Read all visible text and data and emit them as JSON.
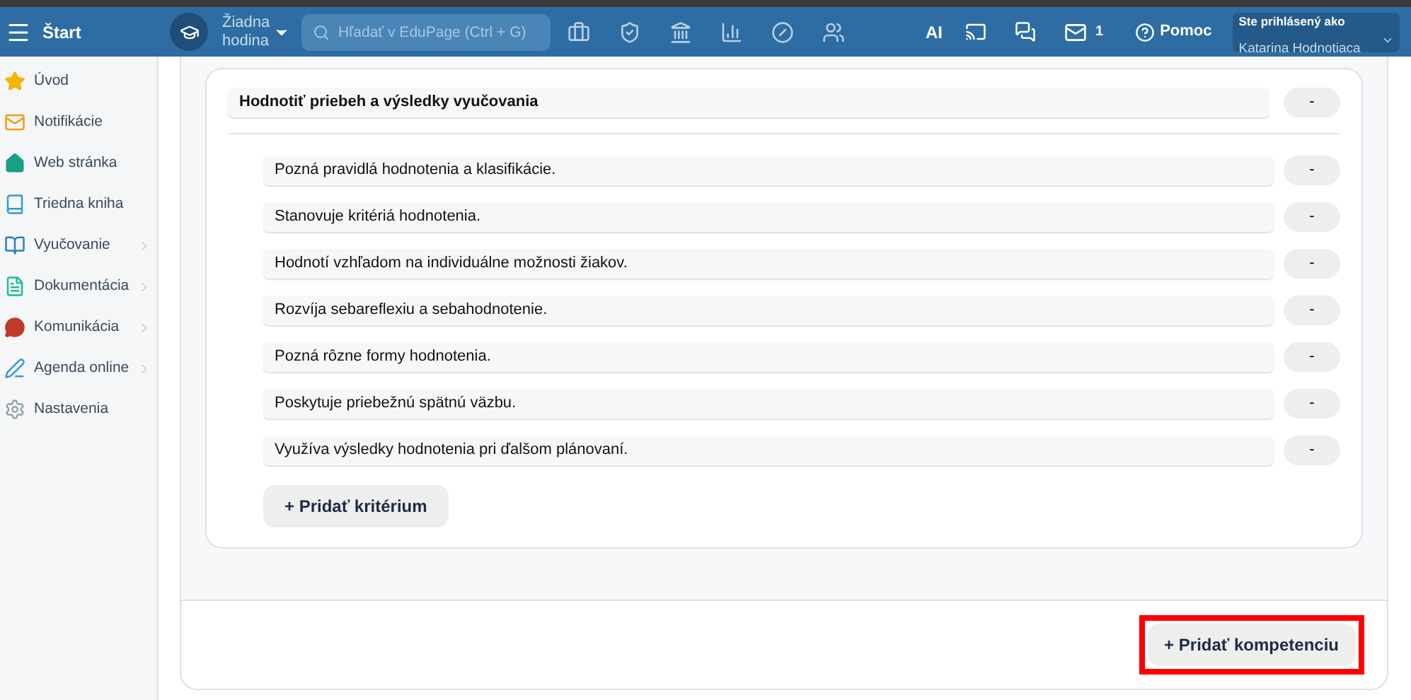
{
  "header": {
    "menu_label": "Štart",
    "lesson": "Žiadna hodina",
    "search": {
      "placeholder": "Hľadať v EduPage (Ctrl + G)"
    },
    "ai_label": "AI",
    "messages_count": "1",
    "help_label": "Pomoc",
    "user": {
      "caption": "Ste prihlásený ako",
      "name": "Katarina Hodnotiaca"
    }
  },
  "sidebar": {
    "items": [
      {
        "kind": "star",
        "label": "Úvod",
        "has_submenu": false
      },
      {
        "kind": "mail",
        "label": "Notifikácie",
        "has_submenu": false
      },
      {
        "kind": "home",
        "label": "Web stránka",
        "has_submenu": false
      },
      {
        "kind": "book",
        "label": "Triedna kniha",
        "has_submenu": false
      },
      {
        "kind": "open-book",
        "label": "Vyučovanie",
        "has_submenu": true
      },
      {
        "kind": "doc",
        "label": "Dokumentácia",
        "has_submenu": true
      },
      {
        "kind": "chat",
        "label": "Komunikácia",
        "has_submenu": true
      },
      {
        "kind": "pen",
        "label": "Agenda online",
        "has_submenu": true
      },
      {
        "kind": "gear",
        "label": "Nastavenia",
        "has_submenu": false
      }
    ]
  },
  "competency": {
    "title": "Hodnotiť priebeh a výsledky vyučovania",
    "score": "-",
    "criteria": [
      {
        "label": "Pozná pravidlá hodnotenia a klasifikácie.",
        "score": "-"
      },
      {
        "label": "Stanovuje kritériá hodnotenia.",
        "score": "-"
      },
      {
        "label": "Hodnotí vzhľadom na individuálne možnosti žiakov.",
        "score": "-"
      },
      {
        "label": "Rozvíja sebareflexiu a sebahodnotenie.",
        "score": "-"
      },
      {
        "label": "Pozná rôzne formy hodnotenia.",
        "score": "-"
      },
      {
        "label": "Poskytuje priebežnú spätnú väzbu.",
        "score": "-"
      },
      {
        "label": "Využíva výsledky hodnotenia pri ďalšom plánovaní.",
        "score": "-"
      }
    ],
    "add_criterion": "+ Pridať kritérium"
  },
  "footer": {
    "add_competency": {
      "label": "+ Pridať kompetenciu",
      "highlighted": true
    }
  }
}
